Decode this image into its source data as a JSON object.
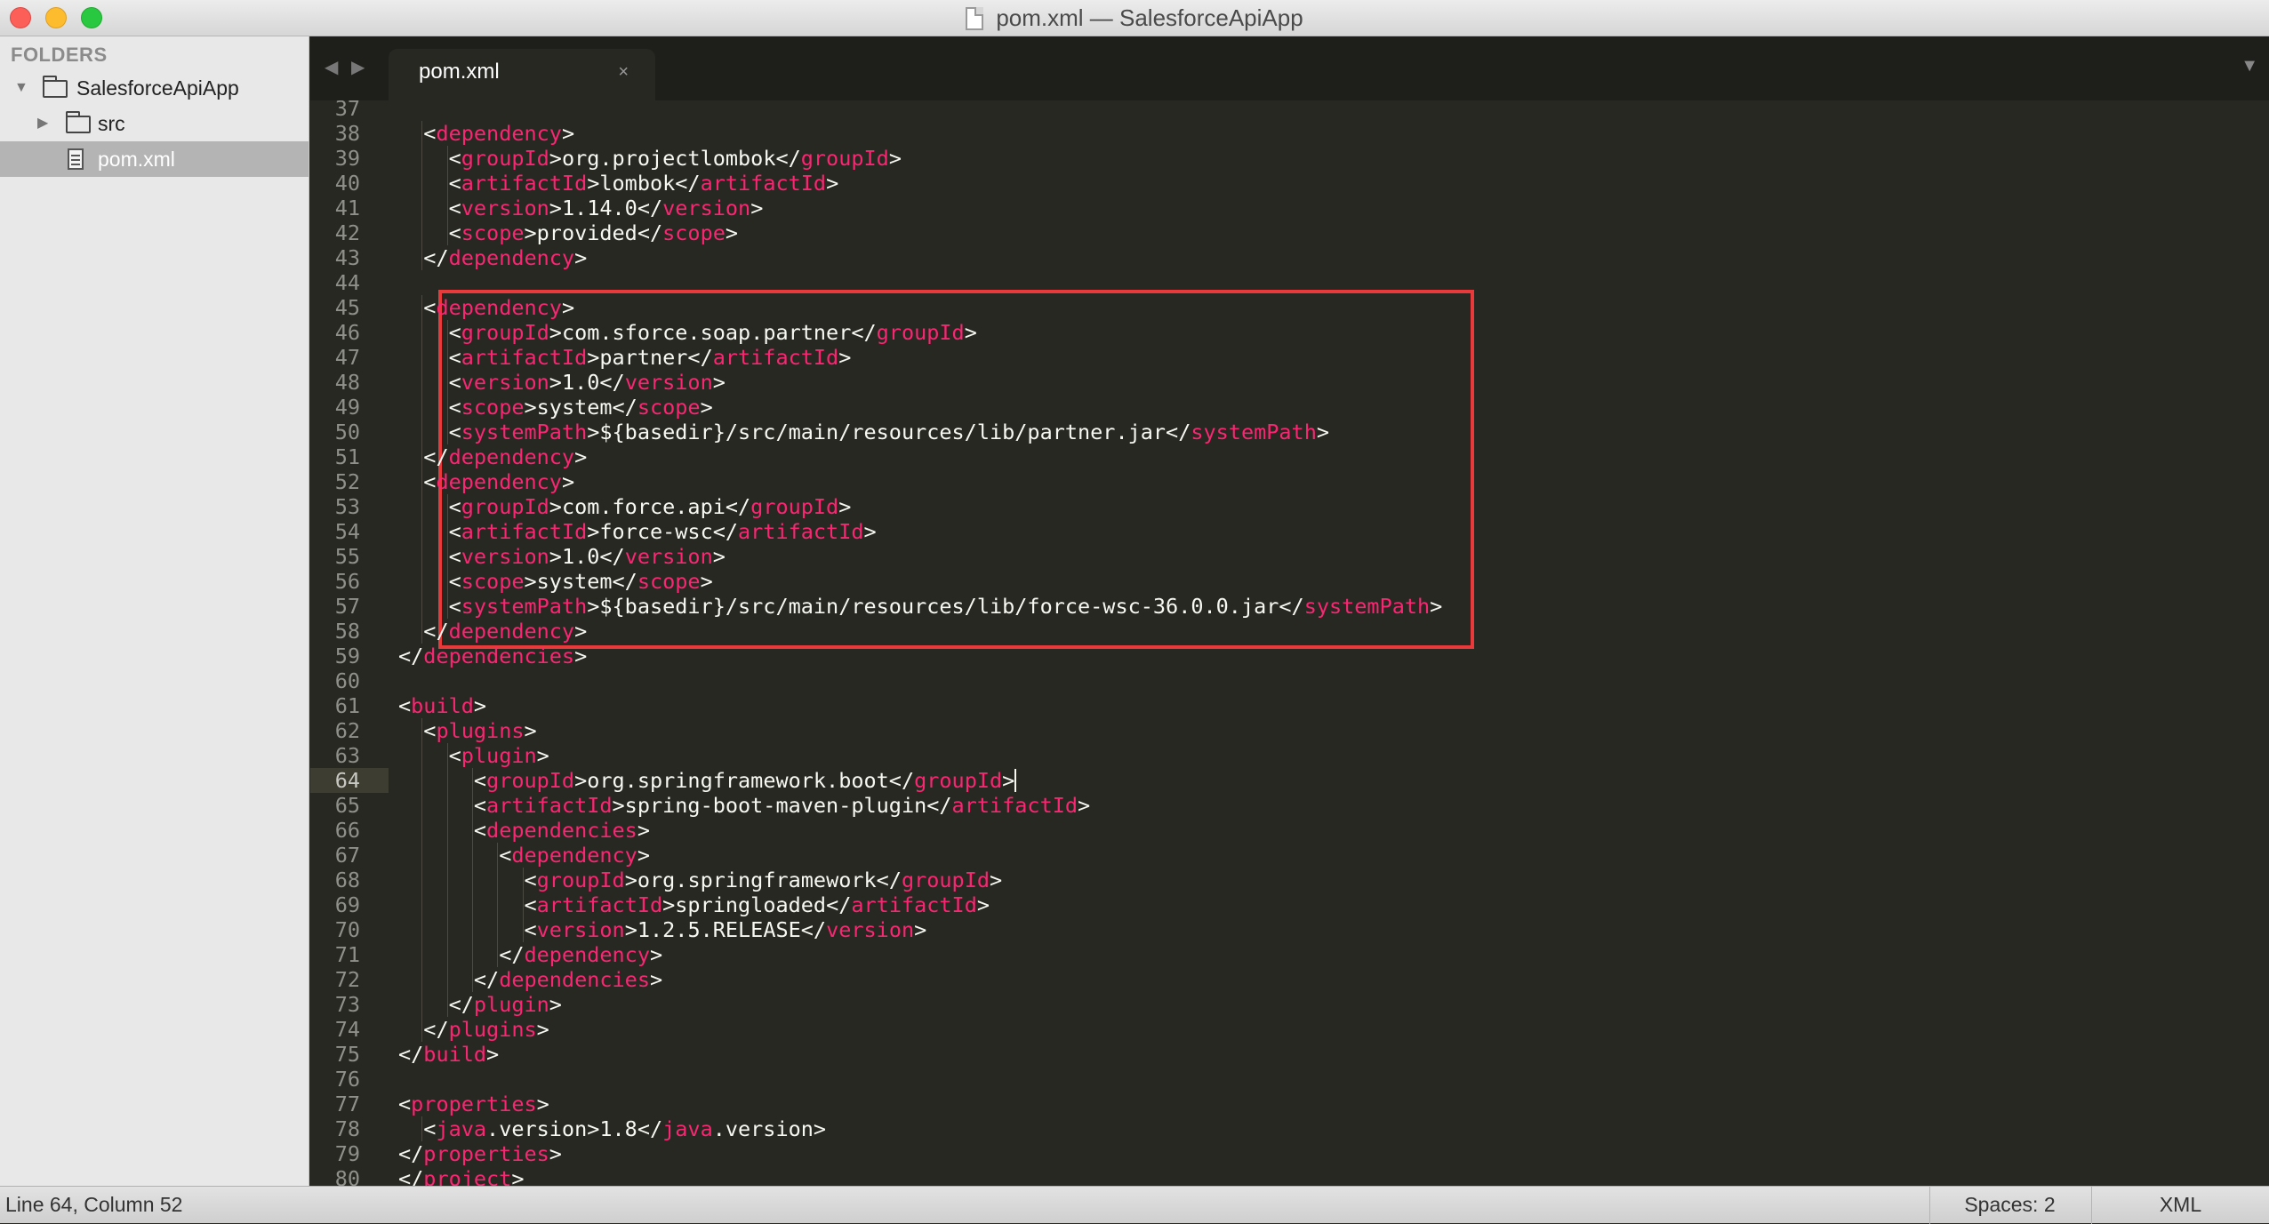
{
  "window": {
    "title": "pom.xml — SalesforceApiApp"
  },
  "sidebar": {
    "heading": "FOLDERS",
    "items": [
      {
        "label": "SalesforceApiApp",
        "type": "folder",
        "expanded": true
      },
      {
        "label": "src",
        "type": "folder",
        "expanded": false
      },
      {
        "label": "pom.xml",
        "type": "file",
        "selected": true
      }
    ]
  },
  "tabs": [
    {
      "label": "pom.xml",
      "close": "×",
      "active": true
    }
  ],
  "tabbar": {
    "back_icon": "◀",
    "forward_icon": "▶",
    "dropdown_icon": "▼"
  },
  "editor": {
    "current_line": 64,
    "highlight_box_lines": [
      45,
      58
    ],
    "lines": [
      {
        "n": "37",
        "indent": 0,
        "tokens": []
      },
      {
        "n": "38",
        "indent": 2,
        "tokens": [
          {
            "t": "<"
          },
          {
            "t": "dependency",
            "k": "tag"
          },
          {
            "t": ">"
          }
        ]
      },
      {
        "n": "39",
        "indent": 3,
        "tokens": [
          {
            "t": "<"
          },
          {
            "t": "groupId",
            "k": "tag"
          },
          {
            "t": ">org.projectlombok</"
          },
          {
            "t": "groupId",
            "k": "tag"
          },
          {
            "t": ">"
          }
        ]
      },
      {
        "n": "40",
        "indent": 3,
        "tokens": [
          {
            "t": "<"
          },
          {
            "t": "artifactId",
            "k": "tag"
          },
          {
            "t": ">lombok</"
          },
          {
            "t": "artifactId",
            "k": "tag"
          },
          {
            "t": ">"
          }
        ]
      },
      {
        "n": "41",
        "indent": 3,
        "tokens": [
          {
            "t": "<"
          },
          {
            "t": "version",
            "k": "tag"
          },
          {
            "t": ">1.14.0</"
          },
          {
            "t": "version",
            "k": "tag"
          },
          {
            "t": ">"
          }
        ]
      },
      {
        "n": "42",
        "indent": 3,
        "tokens": [
          {
            "t": "<"
          },
          {
            "t": "scope",
            "k": "tag"
          },
          {
            "t": ">provided</"
          },
          {
            "t": "scope",
            "k": "tag"
          },
          {
            "t": ">"
          }
        ]
      },
      {
        "n": "43",
        "indent": 2,
        "tokens": [
          {
            "t": "</"
          },
          {
            "t": "dependency",
            "k": "tag"
          },
          {
            "t": ">"
          }
        ]
      },
      {
        "n": "44",
        "indent": 0,
        "tokens": []
      },
      {
        "n": "45",
        "indent": 2,
        "tokens": [
          {
            "t": "<"
          },
          {
            "t": "dependency",
            "k": "tag"
          },
          {
            "t": ">"
          }
        ]
      },
      {
        "n": "46",
        "indent": 3,
        "tokens": [
          {
            "t": "<"
          },
          {
            "t": "groupId",
            "k": "tag"
          },
          {
            "t": ">com.sforce.soap.partner</"
          },
          {
            "t": "groupId",
            "k": "tag"
          },
          {
            "t": ">"
          }
        ]
      },
      {
        "n": "47",
        "indent": 3,
        "tokens": [
          {
            "t": "<"
          },
          {
            "t": "artifactId",
            "k": "tag"
          },
          {
            "t": ">partner</"
          },
          {
            "t": "artifactId",
            "k": "tag"
          },
          {
            "t": ">"
          }
        ]
      },
      {
        "n": "48",
        "indent": 3,
        "tokens": [
          {
            "t": "<"
          },
          {
            "t": "version",
            "k": "tag"
          },
          {
            "t": ">1.0</"
          },
          {
            "t": "version",
            "k": "tag"
          },
          {
            "t": ">"
          }
        ]
      },
      {
        "n": "49",
        "indent": 3,
        "tokens": [
          {
            "t": "<"
          },
          {
            "t": "scope",
            "k": "tag"
          },
          {
            "t": ">system</"
          },
          {
            "t": "scope",
            "k": "tag"
          },
          {
            "t": ">"
          }
        ]
      },
      {
        "n": "50",
        "indent": 3,
        "tokens": [
          {
            "t": "<"
          },
          {
            "t": "systemPath",
            "k": "tag"
          },
          {
            "t": ">${basedir}/src/main/resources/lib/partner.jar</"
          },
          {
            "t": "systemPath",
            "k": "tag"
          },
          {
            "t": ">"
          }
        ]
      },
      {
        "n": "51",
        "indent": 2,
        "tokens": [
          {
            "t": "</"
          },
          {
            "t": "dependency",
            "k": "tag"
          },
          {
            "t": ">"
          }
        ]
      },
      {
        "n": "52",
        "indent": 2,
        "tokens": [
          {
            "t": "<"
          },
          {
            "t": "dependency",
            "k": "tag"
          },
          {
            "t": ">"
          }
        ]
      },
      {
        "n": "53",
        "indent": 3,
        "tokens": [
          {
            "t": "<"
          },
          {
            "t": "groupId",
            "k": "tag"
          },
          {
            "t": ">com.force.api</"
          },
          {
            "t": "groupId",
            "k": "tag"
          },
          {
            "t": ">"
          }
        ]
      },
      {
        "n": "54",
        "indent": 3,
        "tokens": [
          {
            "t": "<"
          },
          {
            "t": "artifactId",
            "k": "tag"
          },
          {
            "t": ">force-wsc</"
          },
          {
            "t": "artifactId",
            "k": "tag"
          },
          {
            "t": ">"
          }
        ]
      },
      {
        "n": "55",
        "indent": 3,
        "tokens": [
          {
            "t": "<"
          },
          {
            "t": "version",
            "k": "tag"
          },
          {
            "t": ">1.0</"
          },
          {
            "t": "version",
            "k": "tag"
          },
          {
            "t": ">"
          }
        ]
      },
      {
        "n": "56",
        "indent": 3,
        "tokens": [
          {
            "t": "<"
          },
          {
            "t": "scope",
            "k": "tag"
          },
          {
            "t": ">system</"
          },
          {
            "t": "scope",
            "k": "tag"
          },
          {
            "t": ">"
          }
        ]
      },
      {
        "n": "57",
        "indent": 3,
        "tokens": [
          {
            "t": "<"
          },
          {
            "t": "systemPath",
            "k": "tag"
          },
          {
            "t": ">${basedir}/src/main/resources/lib/force-wsc-36.0.0.jar</"
          },
          {
            "t": "systemPath",
            "k": "tag"
          },
          {
            "t": ">"
          }
        ]
      },
      {
        "n": "58",
        "indent": 2,
        "tokens": [
          {
            "t": "</"
          },
          {
            "t": "dependency",
            "k": "tag"
          },
          {
            "t": ">"
          }
        ]
      },
      {
        "n": "59",
        "indent": 1,
        "tokens": [
          {
            "t": "</"
          },
          {
            "t": "dependencies",
            "k": "tag"
          },
          {
            "t": ">"
          }
        ]
      },
      {
        "n": "60",
        "indent": 0,
        "tokens": []
      },
      {
        "n": "61",
        "indent": 1,
        "tokens": [
          {
            "t": "<"
          },
          {
            "t": "build",
            "k": "tag"
          },
          {
            "t": ">"
          }
        ]
      },
      {
        "n": "62",
        "indent": 2,
        "tokens": [
          {
            "t": "<"
          },
          {
            "t": "plugins",
            "k": "tag"
          },
          {
            "t": ">"
          }
        ]
      },
      {
        "n": "63",
        "indent": 3,
        "tokens": [
          {
            "t": "<"
          },
          {
            "t": "plugin",
            "k": "tag"
          },
          {
            "t": ">"
          }
        ]
      },
      {
        "n": "64",
        "indent": 4,
        "tokens": [
          {
            "t": "<"
          },
          {
            "t": "groupId",
            "k": "tag"
          },
          {
            "t": ">org.springframework.boot</"
          },
          {
            "t": "groupId",
            "k": "tag"
          },
          {
            "t": ">"
          }
        ],
        "cursor": true
      },
      {
        "n": "65",
        "indent": 4,
        "tokens": [
          {
            "t": "<"
          },
          {
            "t": "artifactId",
            "k": "tag"
          },
          {
            "t": ">spring-boot-maven-plugin</"
          },
          {
            "t": "artifactId",
            "k": "tag"
          },
          {
            "t": ">"
          }
        ]
      },
      {
        "n": "66",
        "indent": 4,
        "tokens": [
          {
            "t": "<"
          },
          {
            "t": "dependencies",
            "k": "tag"
          },
          {
            "t": ">"
          }
        ]
      },
      {
        "n": "67",
        "indent": 5,
        "tokens": [
          {
            "t": "<"
          },
          {
            "t": "dependency",
            "k": "tag"
          },
          {
            "t": ">"
          }
        ]
      },
      {
        "n": "68",
        "indent": 6,
        "tokens": [
          {
            "t": "<"
          },
          {
            "t": "groupId",
            "k": "tag"
          },
          {
            "t": ">org.springframework</"
          },
          {
            "t": "groupId",
            "k": "tag"
          },
          {
            "t": ">"
          }
        ]
      },
      {
        "n": "69",
        "indent": 6,
        "tokens": [
          {
            "t": "<"
          },
          {
            "t": "artifactId",
            "k": "tag"
          },
          {
            "t": ">springloaded</"
          },
          {
            "t": "artifactId",
            "k": "tag"
          },
          {
            "t": ">"
          }
        ]
      },
      {
        "n": "70",
        "indent": 6,
        "tokens": [
          {
            "t": "<"
          },
          {
            "t": "version",
            "k": "tag"
          },
          {
            "t": ">1.2.5.RELEASE</"
          },
          {
            "t": "version",
            "k": "tag"
          },
          {
            "t": ">"
          }
        ]
      },
      {
        "n": "71",
        "indent": 5,
        "tokens": [
          {
            "t": "</"
          },
          {
            "t": "dependency",
            "k": "tag"
          },
          {
            "t": ">"
          }
        ]
      },
      {
        "n": "72",
        "indent": 4,
        "tokens": [
          {
            "t": "</"
          },
          {
            "t": "dependencies",
            "k": "tag"
          },
          {
            "t": ">"
          }
        ]
      },
      {
        "n": "73",
        "indent": 3,
        "tokens": [
          {
            "t": "</"
          },
          {
            "t": "plugin",
            "k": "tag"
          },
          {
            "t": ">"
          }
        ]
      },
      {
        "n": "74",
        "indent": 2,
        "tokens": [
          {
            "t": "</"
          },
          {
            "t": "plugins",
            "k": "tag"
          },
          {
            "t": ">"
          }
        ]
      },
      {
        "n": "75",
        "indent": 1,
        "tokens": [
          {
            "t": "</"
          },
          {
            "t": "build",
            "k": "tag"
          },
          {
            "t": ">"
          }
        ]
      },
      {
        "n": "76",
        "indent": 0,
        "tokens": []
      },
      {
        "n": "77",
        "indent": 1,
        "tokens": [
          {
            "t": "<"
          },
          {
            "t": "properties",
            "k": "tag"
          },
          {
            "t": ">"
          }
        ]
      },
      {
        "n": "78",
        "indent": 2,
        "tokens": [
          {
            "t": "<"
          },
          {
            "t": "java",
            "k": "tag"
          },
          {
            "t": ".version>1.8</"
          },
          {
            "t": "java",
            "k": "tag"
          },
          {
            "t": ".version>"
          }
        ]
      },
      {
        "n": "79",
        "indent": 1,
        "tokens": [
          {
            "t": "</"
          },
          {
            "t": "properties",
            "k": "tag"
          },
          {
            "t": ">"
          }
        ]
      },
      {
        "n": "80",
        "indent": 0,
        "tokens": [
          {
            "t": "</"
          },
          {
            "t": "project",
            "k": "tag"
          },
          {
            "t": ">"
          }
        ]
      }
    ]
  },
  "statusbar": {
    "position": "Line 64, Column 52",
    "indentation": "Spaces: 2",
    "syntax": "XML"
  },
  "colors": {
    "editor_bg": "#272822",
    "text": "#f8f8f2",
    "tag": "#f92672",
    "line_number": "#90908a",
    "highlight_box": "#e8393b"
  }
}
